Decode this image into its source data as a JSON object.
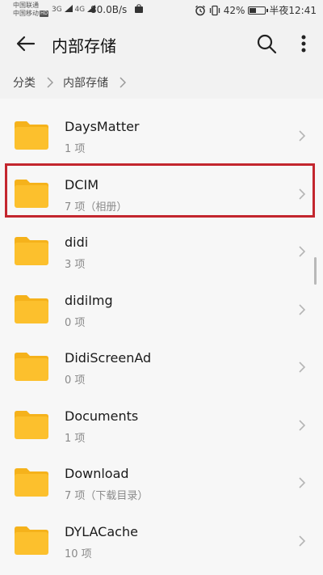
{
  "statusbar": {
    "carrier1": "中国联通",
    "carrier2": "中国移动",
    "hd": "HD",
    "signal1": "3G",
    "signal2": "4G",
    "speed": "80.0B/s",
    "battery_text": "42%",
    "battery_level": 0.42,
    "time": "半夜12:41"
  },
  "header": {
    "title": "内部存储"
  },
  "breadcrumb": {
    "items": [
      "分类",
      "内部存储"
    ]
  },
  "files": [
    {
      "name": "DaysMatter",
      "meta": "1 项"
    },
    {
      "name": "DCIM",
      "meta": "7 项（相册）"
    },
    {
      "name": "didi",
      "meta": "3 项"
    },
    {
      "name": "didiImg",
      "meta": "0 项"
    },
    {
      "name": "DidiScreenAd",
      "meta": "0 项"
    },
    {
      "name": "Documents",
      "meta": "1 项"
    },
    {
      "name": "Download",
      "meta": "7 项（下载目录）"
    },
    {
      "name": "DYLACache",
      "meta": "10 项"
    }
  ],
  "colors": {
    "folder": "#fcc02d",
    "folder_tab": "#f5b21b",
    "highlight": "#c3262e"
  }
}
